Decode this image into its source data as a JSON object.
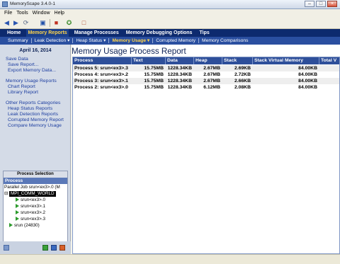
{
  "window": {
    "title": "MemoryScape 3.4.0-1"
  },
  "menu": [
    "File",
    "Tools",
    "Window",
    "Help"
  ],
  "nav1": [
    {
      "label": "Home",
      "active": false
    },
    {
      "label": "Memory Reports",
      "active": true
    },
    {
      "label": "Manage Processes",
      "active": false
    },
    {
      "label": "Memory Debugging Options",
      "active": false
    },
    {
      "label": "Tips",
      "active": false
    }
  ],
  "nav2": [
    {
      "label": "Summary",
      "active": false
    },
    {
      "label": "Leak Detection ▾",
      "active": false
    },
    {
      "label": "Heap Status ▾",
      "active": false
    },
    {
      "label": "Memory Usage ▾",
      "active": true
    },
    {
      "label": "Corrupted Memory",
      "active": false
    },
    {
      "label": "Memory Comparisons",
      "active": false
    }
  ],
  "sidebar": {
    "date": "April 16, 2014",
    "save_header": "Save Data",
    "save_report": "Save Report...",
    "export": "Export Memory Data...",
    "mu_header": "Memory Usage Reports",
    "chart_report": "Chart Report",
    "library_report": "Library Report",
    "other_header": "Other Reports Categories",
    "other_items": [
      "Heap Status Reports",
      "Leak Detection Reports",
      "Corrupted Memory Report",
      "Compare Memory Usage"
    ]
  },
  "process_selection": {
    "title": "Process Selection",
    "column": "Process",
    "parallel_job": "Parallel Job srun<ex3>.0 (M",
    "comm_world": "MPI_COMM_WORLD",
    "ranks": [
      "srun<ex3>.0",
      "srun<ex3>.1",
      "srun<ex3>.2",
      "srun<ex3>.3"
    ],
    "srun": "srun (24830)"
  },
  "report": {
    "title": "Memory Usage Process Report",
    "columns": [
      "Process",
      "Text",
      "Data",
      "Heap",
      "Stack",
      "Stack Virtual Memory",
      "Total V"
    ],
    "rows": [
      {
        "process": "Process 5: srun<ex3>.3",
        "text": "15.75MB",
        "data": "1228.34KB",
        "heap": "2.67MB",
        "stack": "2.69KB",
        "svm": "84.00KB"
      },
      {
        "process": "Process 4: srun<ex3>.2",
        "text": "15.75MB",
        "data": "1228.34KB",
        "heap": "2.67MB",
        "stack": "2.72KB",
        "svm": "84.00KB"
      },
      {
        "process": "Process 3: srun<ex3>.1",
        "text": "15.75MB",
        "data": "1228.34KB",
        "heap": "2.67MB",
        "stack": "2.66KB",
        "svm": "84.00KB"
      },
      {
        "process": "Process 2: srun<ex3>.0",
        "text": "15.75MB",
        "data": "1228.34KB",
        "heap": "6.12MB",
        "stack": "2.08KB",
        "svm": "84.00KB"
      }
    ]
  }
}
